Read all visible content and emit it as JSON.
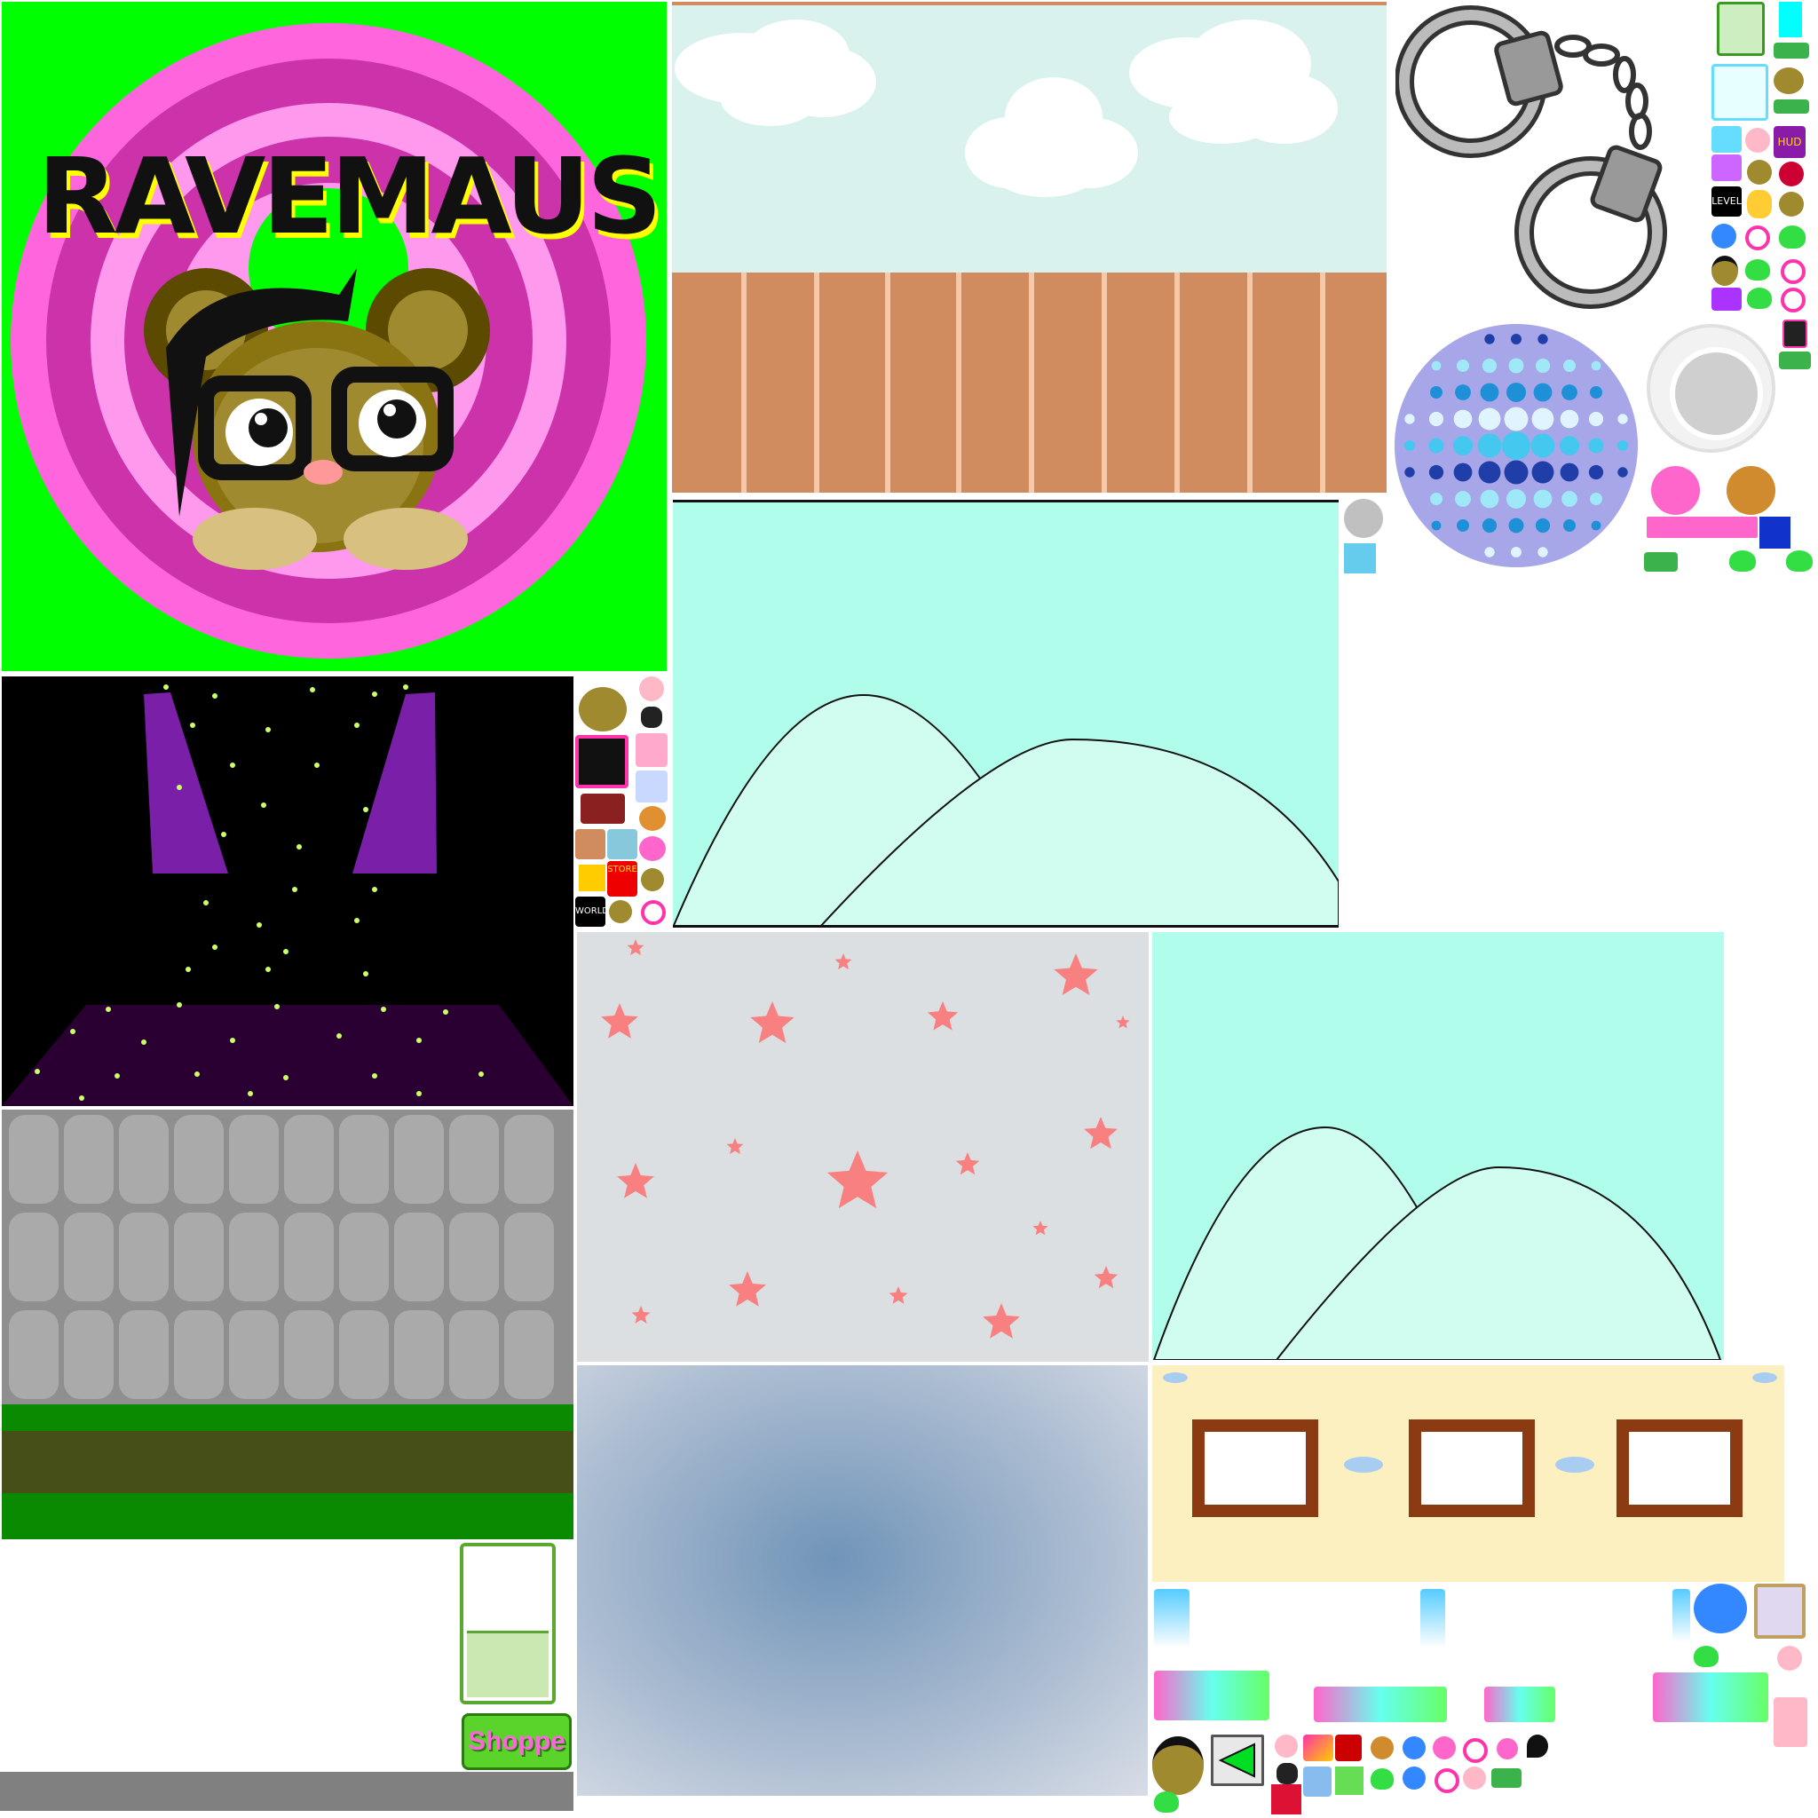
{
  "logo": {
    "title": "RAVEMAUS"
  },
  "labels": {
    "store": "STORE",
    "world": "WORLD",
    "level": "LEVEL",
    "hud": "HUD",
    "shoppe": "Shoppe"
  },
  "colors": {
    "logo_bg": "#00ff00",
    "ring_pink": "#ff66dd",
    "sky": "#d9f2ee",
    "fence": "#d08b5e",
    "mint": "#b0fdeb",
    "night": "#000000",
    "floor": "#2a0033",
    "stone": "#aaaaaa",
    "grass": "#0a8a00",
    "dirt": "#474f19",
    "stars_bg": "#dcdfe2",
    "star": "#f88080",
    "wall": "#fdf0c0",
    "frame": "#8b3a12",
    "disco_bg": "#a6a6e8",
    "disco_dot": "#66e0f8"
  },
  "icons": {
    "handcuffs": "handcuffs-icon",
    "disco_ball": "disco-ball-icon",
    "button_ring": "white-round-button-icon",
    "mouse": "mouse-head-icon",
    "slime": "green-slime-icon",
    "arrow": "green-left-arrow-icon",
    "ring": "pink-ring-icon"
  }
}
